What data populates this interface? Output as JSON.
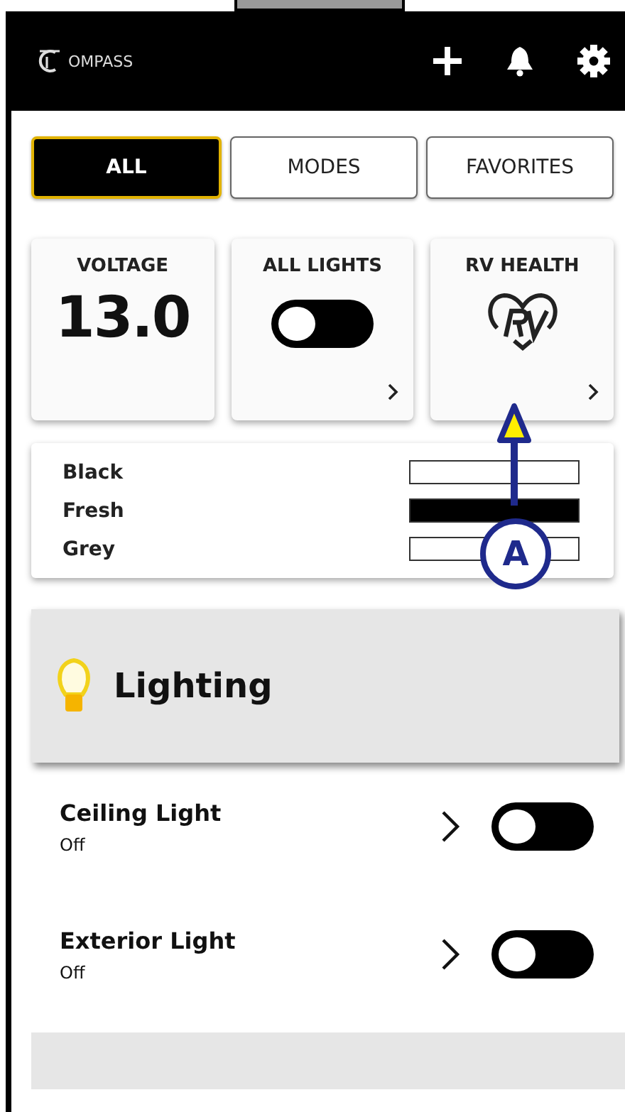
{
  "header": {
    "logo": "OMPASS"
  },
  "tabs": [
    {
      "label": "ALL",
      "selected": true
    },
    {
      "label": "MODES",
      "selected": false
    },
    {
      "label": "FAVORITES",
      "selected": false
    }
  ],
  "tiles": [
    {
      "kind": "value",
      "title": "VOLTAGE",
      "value": "13.0"
    },
    {
      "kind": "toggle",
      "title": "ALL LIGHTS",
      "on": false
    },
    {
      "kind": "logo",
      "title": "RV HEALTH"
    }
  ],
  "tanks": [
    {
      "name": "Black",
      "filled": false
    },
    {
      "name": "Fresh",
      "filled": true
    },
    {
      "name": "Grey",
      "filled": false
    }
  ],
  "section": {
    "title": "Lighting"
  },
  "lights": [
    {
      "name": "Ceiling Light",
      "status": "Off",
      "on": false
    },
    {
      "name": "Exterior Light",
      "status": "Off",
      "on": false
    }
  ],
  "callout": {
    "label": "A"
  }
}
